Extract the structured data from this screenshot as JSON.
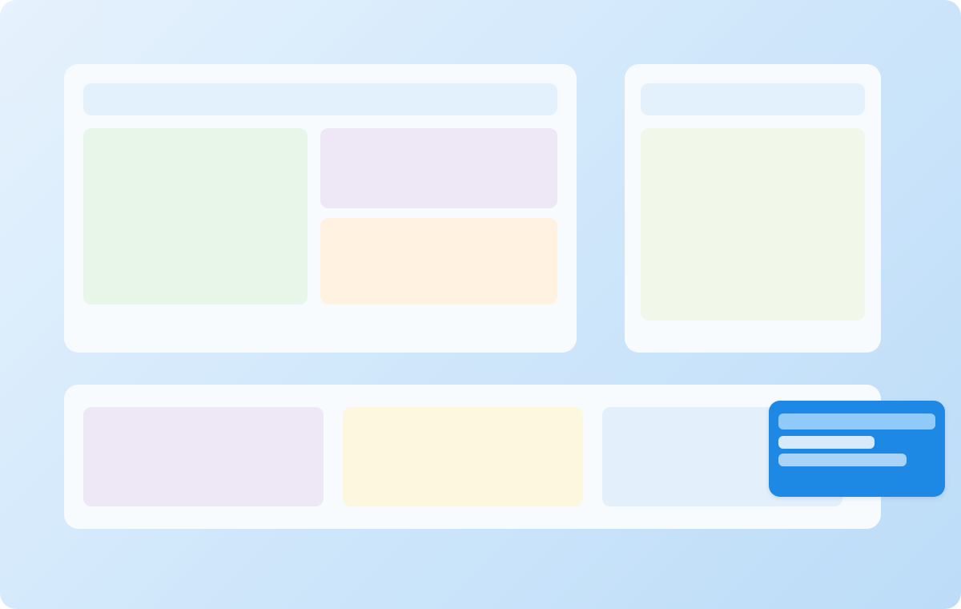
{
  "colors": {
    "background_start": "#e6f2fd",
    "background_end": "#bcdcf8",
    "card": "#f8fbfe",
    "header_bar": "#e3f1fc",
    "green_block": "#e8f5e9",
    "purple_block": "#ede7f6",
    "orange_block": "#fff2e1",
    "light_green_block": "#f1f8e9",
    "yellow_block": "#fdf7e0",
    "blue_block": "#e3f0fb",
    "toast": "#1e88e5",
    "toast_bar_1": "#90caf9",
    "toast_bar_2": "#d7eafc",
    "toast_bar_3": "#a9d3f8"
  },
  "main_panel": {
    "blocks": [
      "header-bar",
      "green-block",
      "purple-block",
      "orange-block"
    ]
  },
  "side_panel": {
    "blocks": [
      "header-bar",
      "green-block"
    ]
  },
  "bottom_panel": {
    "blocks": [
      "purple-block",
      "yellow-block",
      "blue-block"
    ]
  },
  "toast": {
    "lines": 3
  }
}
